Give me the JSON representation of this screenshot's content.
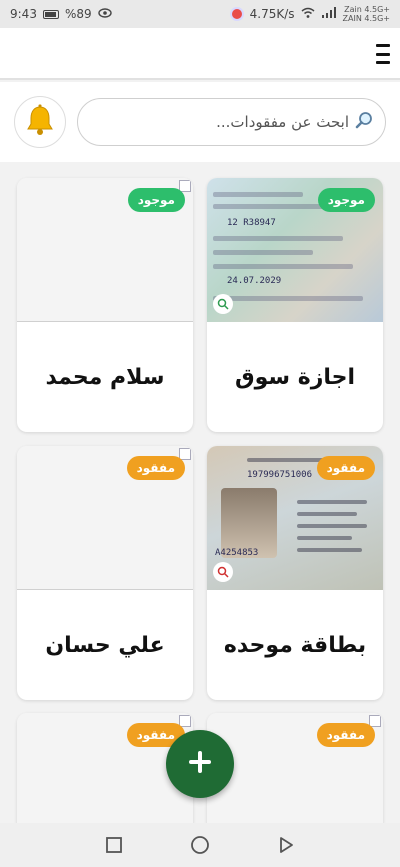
{
  "status_bar": {
    "time": "9:43",
    "battery": "%89",
    "speed": "4.75K/s",
    "carrier_1": "Zain 4.5G+",
    "carrier_2": "ZAIN 4.5G+"
  },
  "search": {
    "placeholder": "ابحث عن مفقودات..."
  },
  "icons": {
    "menu": "hamburger-menu-icon",
    "bell": "bell-icon",
    "search": "magnifier-icon",
    "add": "plus-icon",
    "zoom": "zoom-icon"
  },
  "colors": {
    "found": "#2dbe6c",
    "lost": "#f0a020",
    "fab": "#1f6b34",
    "bell": "#f5b400"
  },
  "items": [
    {
      "title": "اجازة سوق",
      "status": "موجود",
      "doc_number": "12 R38947",
      "doc_date": "24.07.2029"
    },
    {
      "title": "سلام محمد",
      "status": "موجود"
    },
    {
      "title": "بطاقة موحده",
      "status": "مفقود",
      "doc_number": "197996751006",
      "doc_code": "A4254853"
    },
    {
      "title": "علي حسان",
      "status": "مفقود"
    },
    {
      "title": "",
      "status": "مفقود"
    },
    {
      "title": "",
      "status": "مفقود"
    }
  ]
}
